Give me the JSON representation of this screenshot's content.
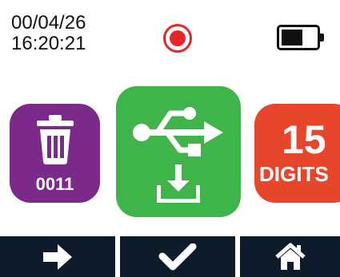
{
  "status": {
    "date": "00/04/26",
    "time": "16:20:21",
    "record_icon": "record-indicator-icon",
    "battery_icon": "battery-icon",
    "battery_level": 0.6
  },
  "tiles": {
    "delete": {
      "icon": "trash-icon",
      "label": "0011",
      "color": "#7b2a8c"
    },
    "usb": {
      "icon": "usb-icon",
      "sub_icon": "download-icon",
      "color": "#3eb44b"
    },
    "digits": {
      "number": "15",
      "word": "DIGITS",
      "color": "#e8462a"
    }
  },
  "toolbar": {
    "buttons": [
      {
        "icon": "arrow-right-icon"
      },
      {
        "icon": "checkmark-icon"
      },
      {
        "icon": "home-icon"
      }
    ],
    "color": "#0d1b2a"
  },
  "colors": {
    "record": "#e3262b"
  }
}
